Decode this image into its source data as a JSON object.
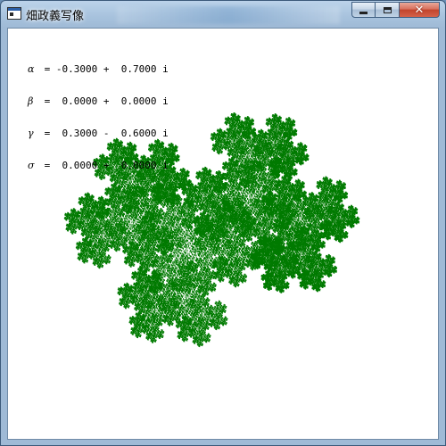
{
  "window": {
    "title": "畑政義写像",
    "controls": {
      "minimize_icon": "minimize-icon",
      "maximize_icon": "maximize-icon",
      "close_icon": "close-icon"
    }
  },
  "parameters": [
    {
      "symbol": "α",
      "text": " = -0.3000 +  0.7000 i"
    },
    {
      "symbol": "β",
      "text": " =  0.0000 +  0.0000 i"
    },
    {
      "symbol": "γ",
      "text": " =  0.3000 -  0.6000 i"
    },
    {
      "symbol": "σ",
      "text": " =  0.0000 +  0.0000 i"
    }
  ],
  "fractal": {
    "color": "#007a00",
    "background": "#ffffff",
    "alpha": {
      "re": -0.3,
      "im": 0.7
    },
    "beta": {
      "re": 0.0,
      "im": 0.0
    },
    "gamma": {
      "re": 0.3,
      "im": -0.6
    },
    "delta": {
      "re": 0.0,
      "im": 0.0
    }
  }
}
